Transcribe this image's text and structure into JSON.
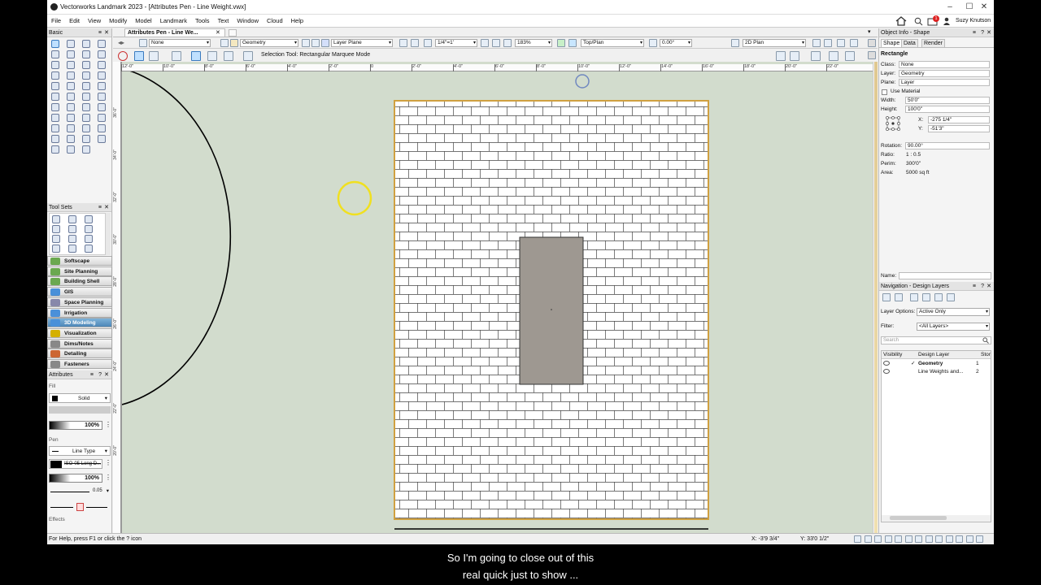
{
  "window": {
    "title": "Vectorworks Landmark 2023 - [Attributes Pen - Line Weight.vwx]",
    "controls": [
      "–",
      "☐",
      "✕"
    ]
  },
  "menubar": {
    "items": [
      "File",
      "Edit",
      "View",
      "Modify",
      "Model",
      "Landmark",
      "Tools",
      "Text",
      "Window",
      "Cloud",
      "Help"
    ],
    "user": "Suzy Knutson",
    "notification_count": "1"
  },
  "doc_tab": "Attributes Pen - Line We...",
  "view_bar": {
    "class_value": "None",
    "layer_value": "Geometry",
    "plane_value": "Layer Plane",
    "scale_value": "1/4\"=1'",
    "zoom_value": "183%",
    "view_value": "Top/Plan",
    "rotation_value": "0.00°",
    "render_value": "2D Plan"
  },
  "tool_bar": {
    "mode_label": "Selection Tool: Rectangular Marquee Mode"
  },
  "palettes": {
    "basic_title": "Basic",
    "toolsets_title": "Tool Sets",
    "tool_sets": [
      {
        "label": "Softscape",
        "color": "#6aa84f"
      },
      {
        "label": "Site Planning",
        "color": "#6aa84f"
      },
      {
        "label": "Building Shell",
        "color": "#6aa84f"
      },
      {
        "label": "GIS",
        "color": "#4a90d9"
      },
      {
        "label": "Space Planning",
        "color": "#8888aa"
      },
      {
        "label": "Irrigation",
        "color": "#4a90d9"
      },
      {
        "label": "3D Modeling",
        "color": "#4a90d9"
      },
      {
        "label": "Visualization",
        "color": "#d4b000"
      },
      {
        "label": "Dims/Notes",
        "color": "#888888"
      },
      {
        "label": "Detailing",
        "color": "#cc6633"
      },
      {
        "label": "Fasteners",
        "color": "#888888"
      }
    ],
    "active_tool_set": "3D Modeling",
    "attributes_title": "Attributes",
    "fill_label": "Fill",
    "fill_style": "Solid",
    "fill_opacity": "100%",
    "pen_label": "Pen",
    "pen_type": "Line Type",
    "pen_style": "ISO-05 Long D...",
    "pen_opacity": "100%",
    "line_weight": "0.05",
    "effects_label": "Effects"
  },
  "rulers": {
    "h_ticks": [
      "12'-0\"",
      "10'-0\"",
      "8'-0\"",
      "6'-0\"",
      "4'-0\"",
      "2'-0\"",
      "0",
      "2'-0\"",
      "4'-0\"",
      "6'-0\"",
      "8'-0\"",
      "10'-0\"",
      "12'-0\"",
      "14'-0\"",
      "16'-0\"",
      "18'-0\"",
      "20'-0\"",
      "22'-0\""
    ],
    "v_ticks": [
      "36'-0\"",
      "34'-0\"",
      "32'-0\"",
      "30'-0\"",
      "28'-0\"",
      "26'-0\"",
      "24'-0\"",
      "22'-0\"",
      "20'-0\""
    ]
  },
  "object_info": {
    "title": "Object Info - Shape",
    "tabs": [
      "Shape",
      "Data",
      "Render"
    ],
    "object_type": "Rectangle",
    "class_label": "Class:",
    "class_value": "None",
    "layer_label": "Layer:",
    "layer_value": "Geometry",
    "plane_label": "Plane:",
    "plane_value": "Layer",
    "use_material": "Use Material",
    "width_label": "Width:",
    "width_value": "50'0\"",
    "height_label": "Height:",
    "height_value": "100'0\"",
    "x_label": "X:",
    "x_value": "-275 1/4\"",
    "y_label": "Y:",
    "y_value": "-51'3\"",
    "rotation_label": "Rotation:",
    "rotation_value": "90.00°",
    "ratio_label": "Ratio:",
    "ratio_value": "1 : 0.5",
    "perim_label": "Perim:",
    "perim_value": "300'0\"",
    "area_label": "Area:",
    "area_value": "5000 sq ft",
    "name_label": "Name:"
  },
  "navigation": {
    "title": "Navigation - Design Layers",
    "layer_options_label": "Layer Options:",
    "layer_options_value": "Active Only",
    "filter_label": "Filter:",
    "filter_value": "<All Layers>",
    "search_placeholder": "Search",
    "columns": [
      "Visibility",
      "Design Layer",
      "Stor"
    ],
    "layers": [
      {
        "name": "Geometry",
        "num": "1",
        "active": true
      },
      {
        "name": "Line Weights and...",
        "num": "2",
        "active": false
      }
    ]
  },
  "status": {
    "help_text": "For Help, press F1 or click the ? icon",
    "x_coord": "X: -3'9 3/4\"",
    "y_coord": "Y: 33'0 1/2\""
  },
  "captions": [
    "So I'm going to close out of this",
    "real quick just to show ..."
  ]
}
